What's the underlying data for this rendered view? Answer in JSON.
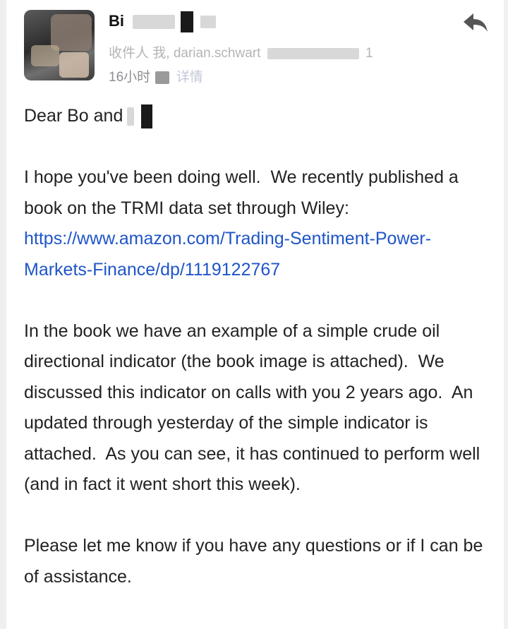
{
  "email": {
    "sender": {
      "name_visible": "Bi",
      "avatar_icon": "avatar-photo"
    },
    "recipients_visible": "收件人 我, darian.schwart",
    "recipients_suffix": "1",
    "time_visible": "16小时",
    "details_label": "详情",
    "reply_icon": "reply-arrow-icon"
  },
  "message": {
    "greeting": "Dear Bo and",
    "para1_text": "I hope you've been doing well.  We recently published a book on the TRMI data set through Wiley:  ",
    "para1_link": "https://www.amazon.com/Trading-Sentiment-Power-Markets-Finance/dp/1119122767",
    "para2": "In the book we have an example of a simple crude oil directional indicator (the book image is attached).  We discussed this indicator on calls with you 2 years ago.  An updated through yesterday of the simple indicator is attached.  As you can see, it has continued to perform well (and in fact it went short this week).",
    "para3": "Please let me know if you have any questions or if I can be of assistance."
  },
  "colors": {
    "link": "#1f55c8",
    "body_text": "#222222",
    "meta_text": "#8e8e93",
    "reply_icon": "#555555"
  }
}
